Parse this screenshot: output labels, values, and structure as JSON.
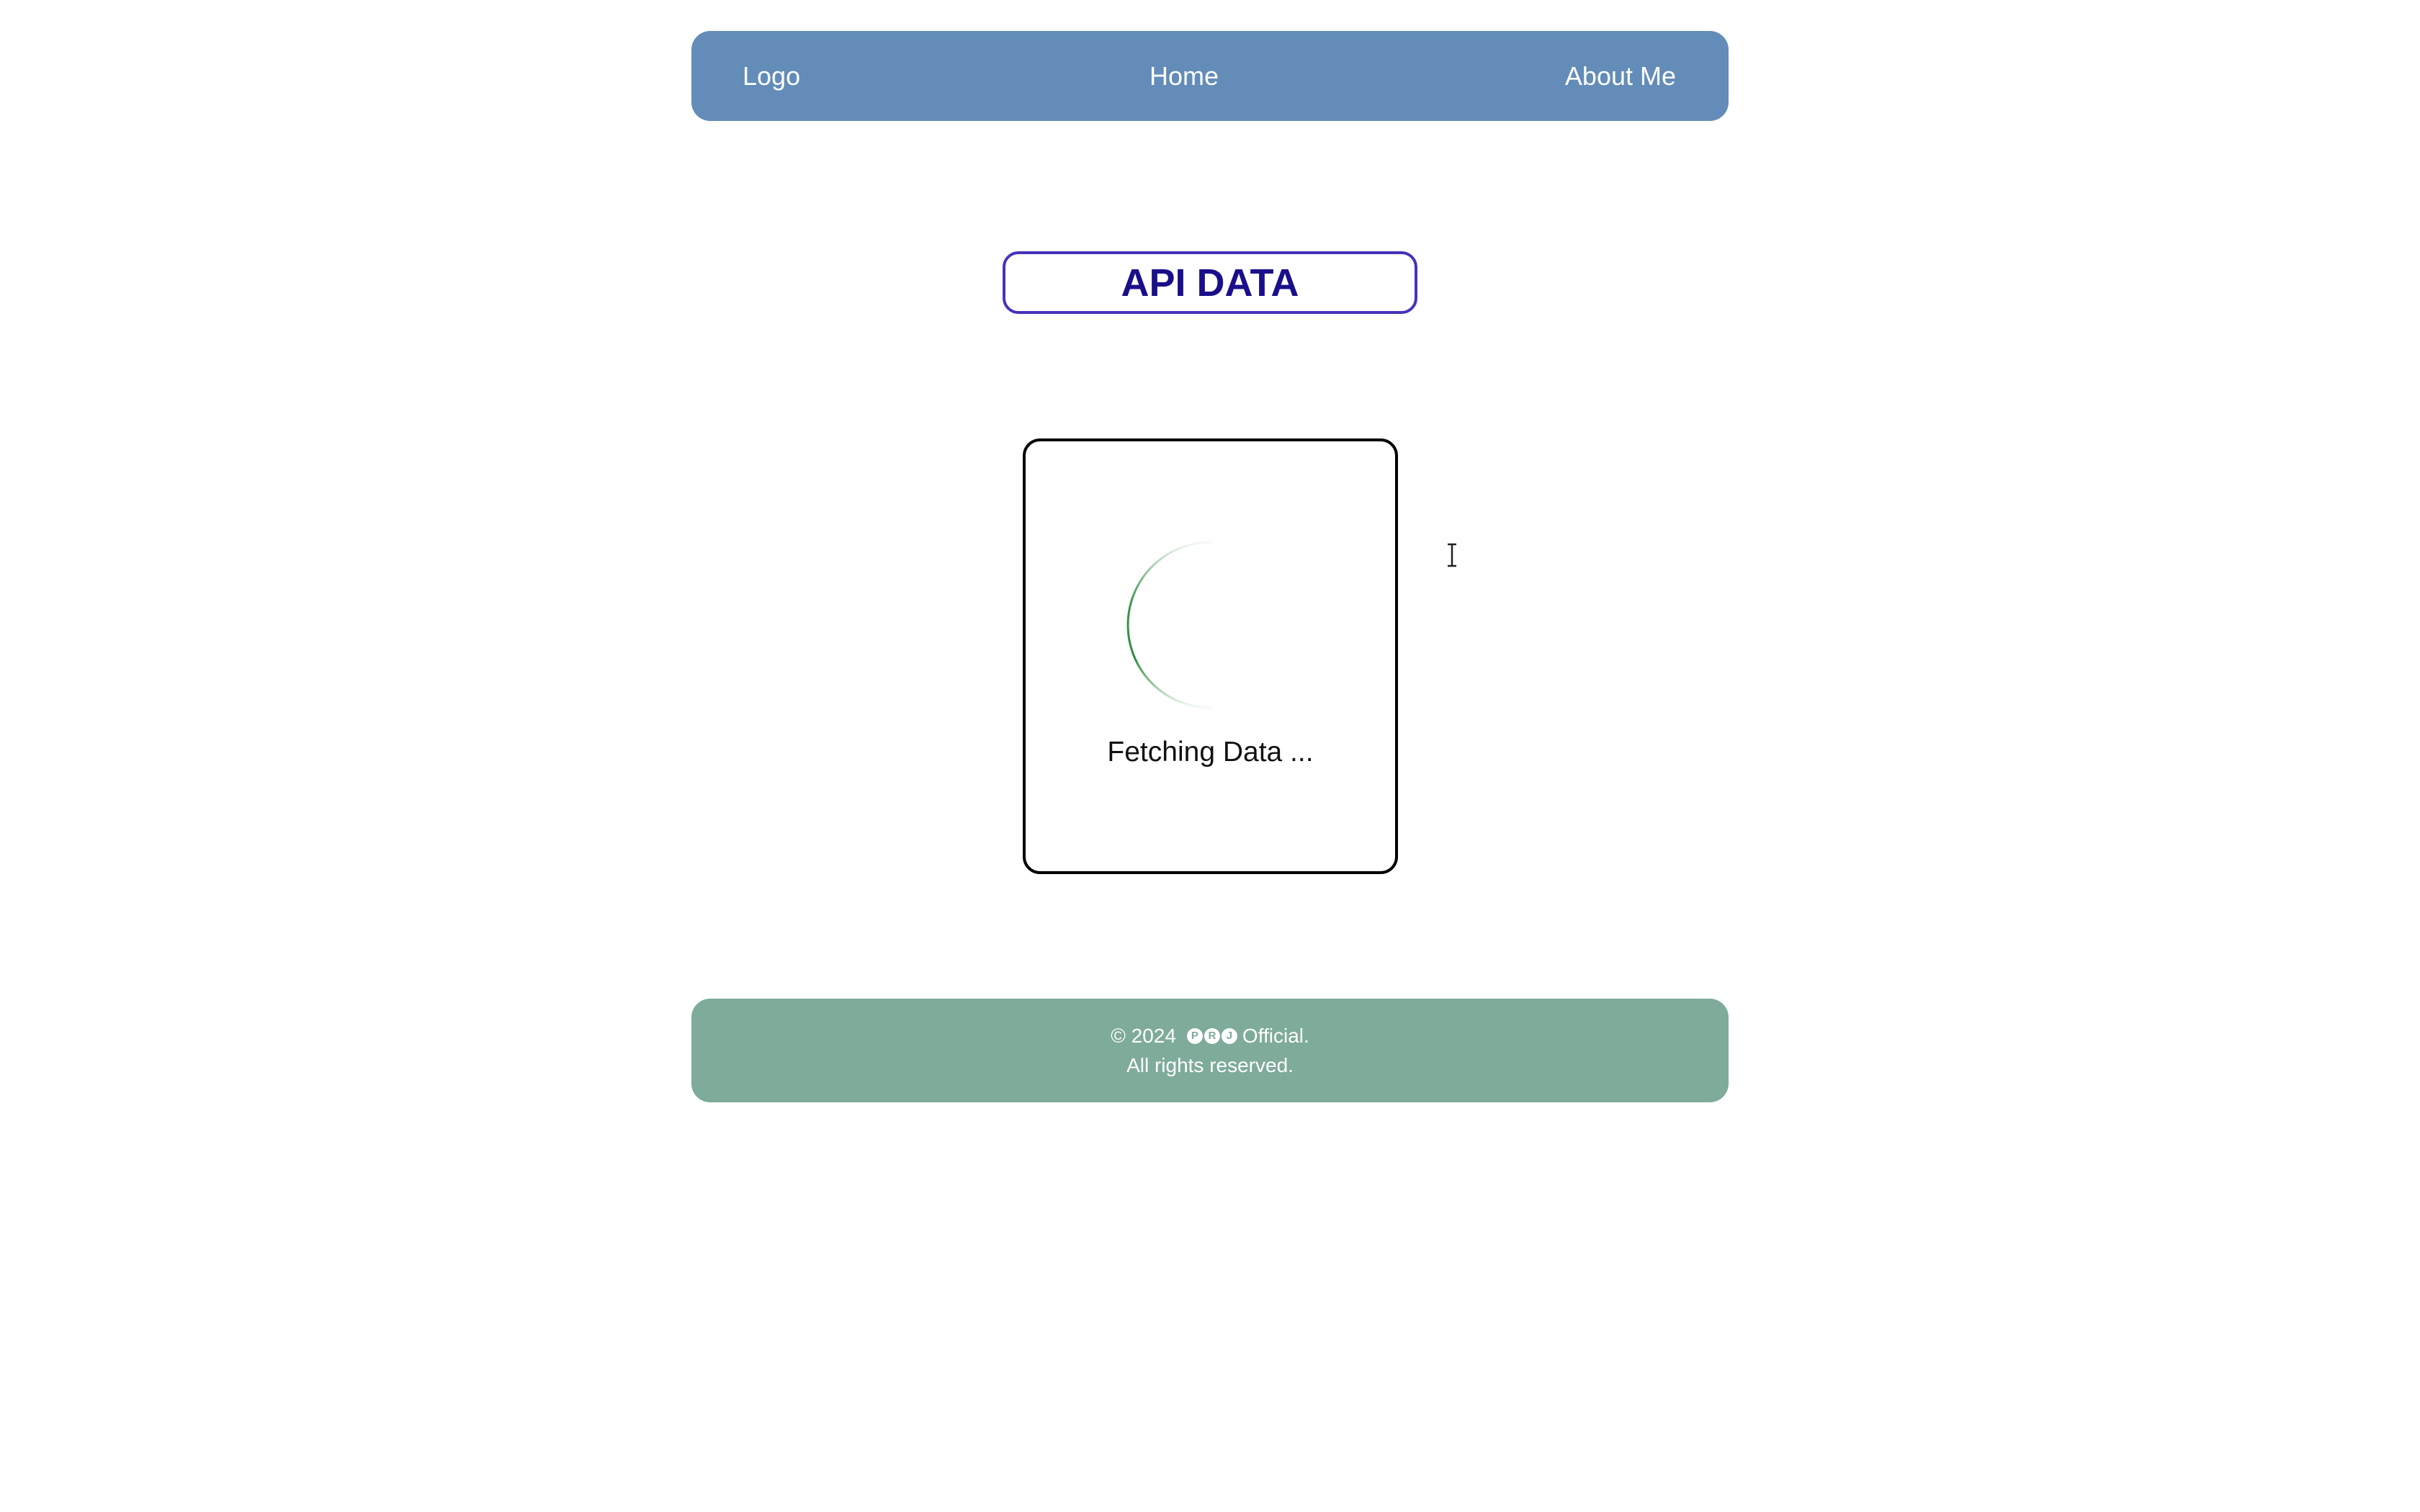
{
  "navbar": {
    "logo": "Logo",
    "home": "Home",
    "about": "About Me"
  },
  "main": {
    "title": "API DATA",
    "loading_card": {
      "status": "Fetching Data ...",
      "spinner_icon": "loading-spinner-icon"
    }
  },
  "footer": {
    "copyright": "© 2024",
    "brand_letters": [
      "P",
      "R",
      "J"
    ],
    "brand_suffix": "Official.",
    "rights": "All rights reserved."
  },
  "colors": {
    "navbar_bg": "#638cb8",
    "footer_bg": "#7eab9a",
    "title_text": "#1a0f8a",
    "title_border": "#4433bb",
    "spinner": "#2e8b3e"
  }
}
